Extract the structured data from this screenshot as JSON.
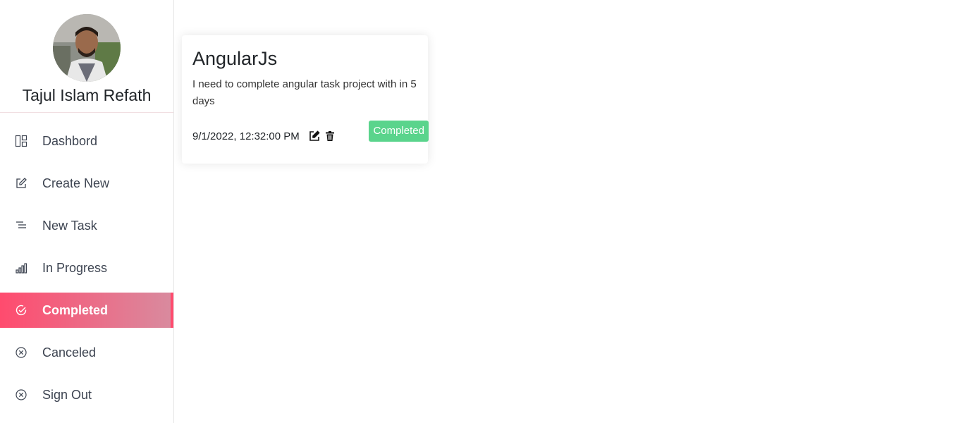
{
  "profile": {
    "name": "Tajul Islam Refath"
  },
  "sidebar": {
    "items": [
      {
        "label": "Dashbord",
        "icon": "dashboard-icon"
      },
      {
        "label": "Create New",
        "icon": "edit-icon"
      },
      {
        "label": "New Task",
        "icon": "list-icon"
      },
      {
        "label": "In Progress",
        "icon": "bar-chart-icon"
      },
      {
        "label": "Completed",
        "icon": "check-circle-icon",
        "active": true
      },
      {
        "label": "Canceled",
        "icon": "x-circle-icon"
      },
      {
        "label": "Sign Out",
        "icon": "x-circle-icon"
      }
    ]
  },
  "tasks": [
    {
      "title": "AngularJs",
      "description": "I need to complete angular task project with in 5 days",
      "date": "9/1/2022, 12:32:00 PM",
      "status": "Completed"
    }
  ],
  "colors": {
    "accent": "#ff4b6e",
    "status_completed": "#5ad48c"
  }
}
